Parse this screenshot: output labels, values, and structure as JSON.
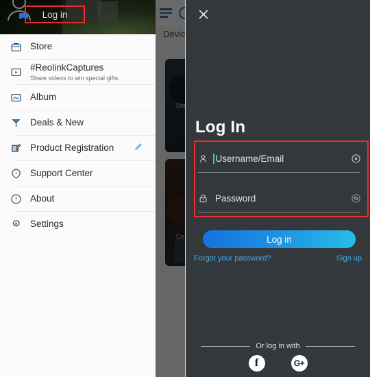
{
  "background_app": {
    "tab_label": "Device",
    "hamburger_icon": "menu-icon",
    "circle_button_icon": "circle-button-icon",
    "cards": [
      {
        "label": "Sto"
      },
      {
        "label": "Co"
      }
    ]
  },
  "drawer": {
    "header": {
      "avatar_icon": "person-avatar-icon",
      "flag_badge_icon": "flag-badge-icon",
      "login_label": "Log in"
    },
    "items": [
      {
        "label": "Store",
        "sub": "",
        "icon": "store-icon",
        "action": ""
      },
      {
        "label": "#ReolinkCaptures",
        "sub": "Share videos to win special gifts.",
        "icon": "video-play-icon",
        "action": ""
      },
      {
        "label": "Album",
        "sub": "",
        "icon": "album-icon",
        "action": ""
      },
      {
        "label": "Deals & New",
        "sub": "",
        "icon": "megaphone-icon",
        "action": ""
      },
      {
        "label": "Product Registration",
        "sub": "",
        "icon": "edit-document-icon",
        "action": "pencil-icon"
      },
      {
        "label": "Support Center",
        "sub": "",
        "icon": "support-chat-icon",
        "action": ""
      },
      {
        "label": "About",
        "sub": "",
        "icon": "info-icon",
        "action": ""
      },
      {
        "label": "Settings",
        "sub": "",
        "icon": "gear-icon",
        "action": ""
      }
    ]
  },
  "login_panel": {
    "close_icon": "close-icon",
    "title": "Log In",
    "fields": {
      "username": {
        "placeholder": "Username/Email",
        "leading_icon": "person-icon",
        "trailing_icon": "clear-circle-x-icon",
        "value": ""
      },
      "password": {
        "placeholder": "Password",
        "leading_icon": "lock-icon",
        "trailing_icon": "eye-off-icon",
        "value": ""
      }
    },
    "submit_label": "Log in",
    "forgot_label": "Forgot your password?",
    "signup_label": "Sign up",
    "or_label": "Or log in with",
    "socials": [
      {
        "name": "facebook",
        "glyph": "f"
      },
      {
        "name": "google-plus",
        "glyph": "G+"
      }
    ]
  },
  "colors": {
    "accent_blue": "#1473dd",
    "accent_cyan": "#26bce6",
    "highlight_red": "#ef2a2a",
    "panel_bg": "#33383d",
    "drawer_bg": "#fbfbfb",
    "link_blue": "#4aa8e8",
    "caret_teal": "#19d7c8"
  }
}
